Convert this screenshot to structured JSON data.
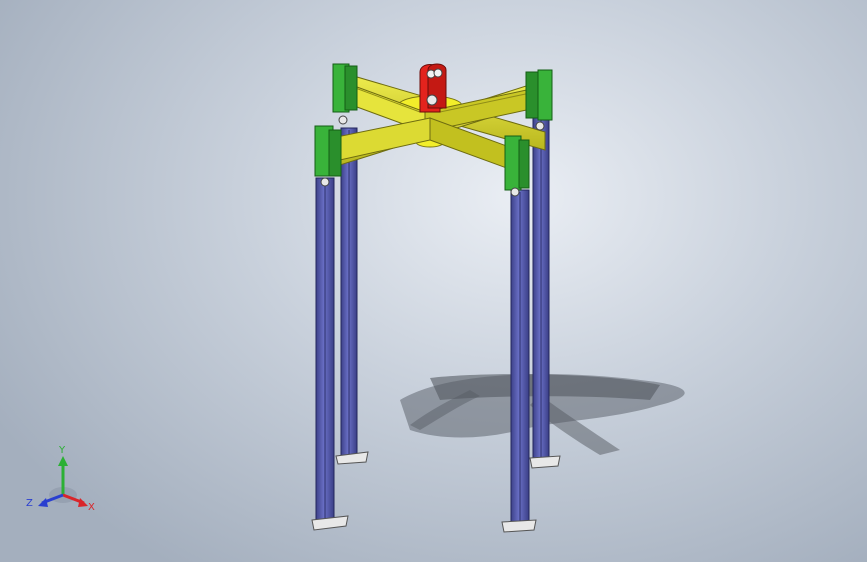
{
  "viewport": {
    "background_top": "#eaeef4",
    "background_bottom": "#a4afbe"
  },
  "model": {
    "components": [
      {
        "name": "lifting-lug",
        "color": "#e3231d"
      },
      {
        "name": "center-plate",
        "color": "#f2ee2a"
      },
      {
        "name": "cross-beams",
        "color": "#d6d42a"
      },
      {
        "name": "end-brackets",
        "color": "#39b33a"
      },
      {
        "name": "legs",
        "color": "#5a5fb0"
      }
    ],
    "leg_count": 4
  },
  "triad": {
    "x_label": "X",
    "y_label": "Y",
    "z_label": "Z",
    "x_color": "#d9252a",
    "y_color": "#2bb034",
    "z_color": "#2a3fd0"
  }
}
